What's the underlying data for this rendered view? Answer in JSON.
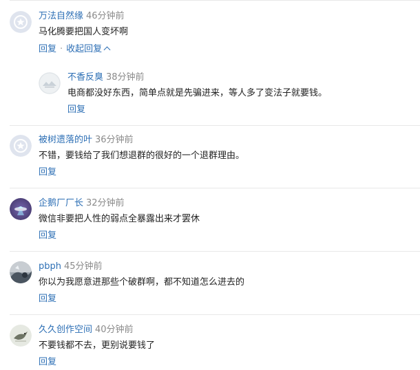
{
  "comments": [
    {
      "name": "万法自然缘",
      "time": "46分钟前",
      "text": "马化腾要把国人变坏啊",
      "reply_label": "回复",
      "collapse_label": "收起回复",
      "avatar": "default-star-avatar",
      "replies": [
        {
          "name": "不香反臭",
          "time": "38分钟前",
          "text": "电商都没好东西，简单点就是先骗进来，等人多了变法子就要钱。",
          "reply_label": "回复",
          "avatar": "landscape-avatar"
        }
      ]
    },
    {
      "name": "被树遗落的叶",
      "time": "36分钟前",
      "text": "不错，要钱给了我们想退群的很好的一个退群理由。",
      "reply_label": "回复",
      "avatar": "default-star-avatar"
    },
    {
      "name": "企鹅厂厂长",
      "time": "32分钟前",
      "text": "微信非要把人性的弱点全暴露出来才罢休",
      "reply_label": "回复",
      "avatar": "ufo-avatar"
    },
    {
      "name": "pbph",
      "time": "45分钟前",
      "text": "你以为我愿意进那些个破群啊，都不知道怎么进去的",
      "reply_label": "回复",
      "avatar": "photo-avatar"
    },
    {
      "name": "久久创作空间",
      "time": "40分钟前",
      "text": "不要钱都不去，更别说要钱了",
      "reply_label": "回复",
      "avatar": "bird-avatar"
    }
  ]
}
